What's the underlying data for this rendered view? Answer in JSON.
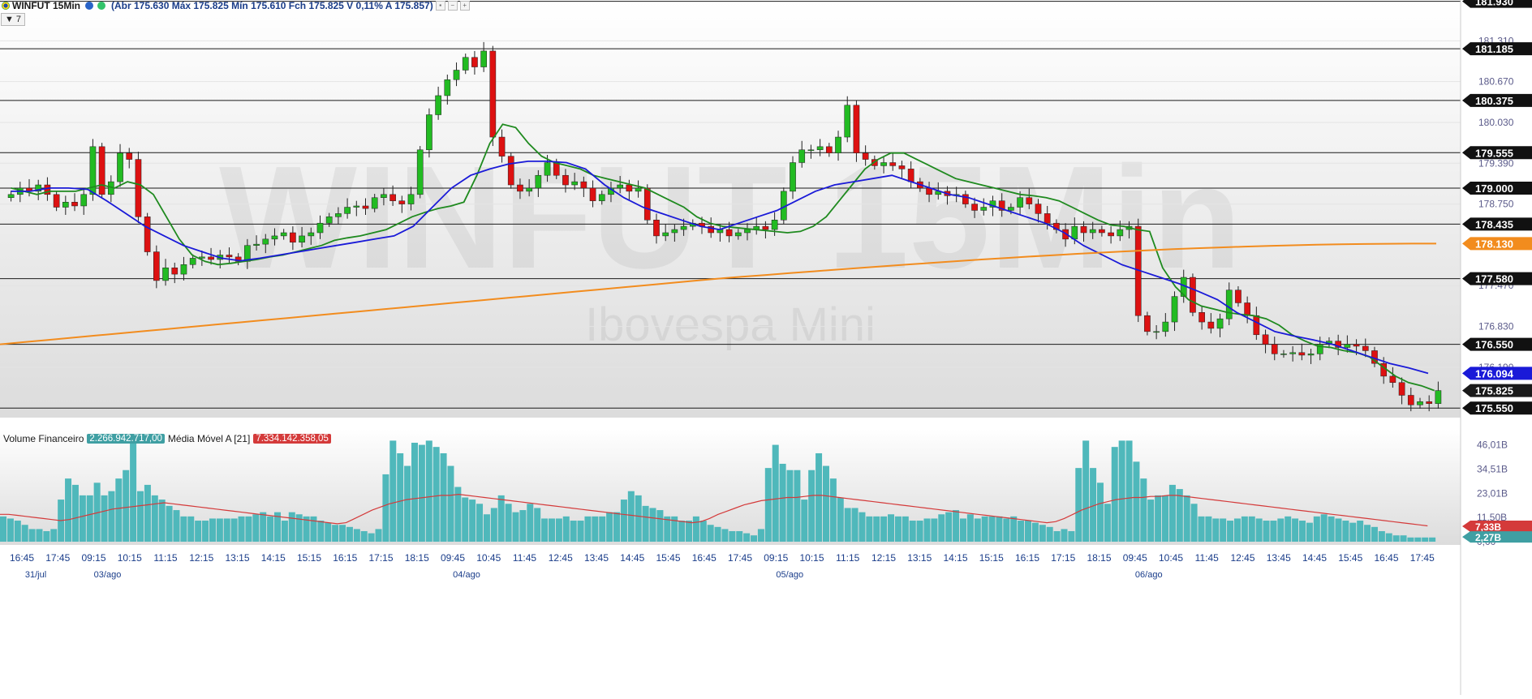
{
  "header": {
    "symbol": "WINFUT 15Min",
    "ohlc_text": "(Abr 175.630 Máx 175.825 Mín 175.610 Fch 175.825 V 0,11% A 175.857)",
    "collapse_label": "7"
  },
  "watermark": {
    "main": "WINFUT 15Min",
    "sub": "Ibovespa Mini"
  },
  "colors": {
    "up": "#22bb22",
    "down": "#dd1111",
    "ma_fast": "#1f8a1f",
    "ma_mid": "#1a1ad8",
    "ma_slow": "#f28c1e",
    "volume": "#4fb8bb",
    "volume_ma": "#d43a3a"
  },
  "chart_data": [
    {
      "type": "candlestick",
      "title": "WINFUT 15Min",
      "ylim": [
        175.4,
        181.95
      ],
      "price_ticks": [
        "181.310",
        "180.670",
        "180.030",
        "179.390",
        "178.750",
        "177.470",
        "176.830",
        "176.190"
      ],
      "horizontal_levels": [
        181.93,
        181.185,
        180.375,
        179.555,
        179.0,
        178.435,
        177.58,
        176.55,
        175.55
      ],
      "level_labels": [
        "181.930",
        "181.185",
        "180.375",
        "179.555",
        "179.000",
        "178.435",
        "177.580",
        "176.550",
        "175.550"
      ],
      "badges": [
        {
          "label": "178.130",
          "value": 178.13,
          "color": "#f28c1e"
        },
        {
          "label": "176.094",
          "value": 176.094,
          "color": "#1a1ad8"
        },
        {
          "label": "175.825",
          "value": 175.825,
          "color": "#1a1a1a"
        }
      ],
      "candles_close": [
        178.9,
        179.0,
        178.95,
        179.05,
        178.9,
        178.7,
        178.78,
        178.72,
        178.9,
        179.65,
        178.9,
        179.1,
        179.55,
        179.45,
        178.55,
        178.0,
        177.55,
        177.75,
        177.65,
        177.8,
        177.9,
        177.92,
        177.88,
        177.95,
        177.92,
        177.85,
        178.1,
        178.12,
        178.2,
        178.25,
        178.3,
        178.15,
        178.25,
        178.3,
        178.45,
        178.55,
        178.6,
        178.7,
        178.72,
        178.68,
        178.85,
        178.9,
        178.8,
        178.75,
        178.9,
        179.6,
        180.15,
        180.45,
        180.7,
        180.85,
        181.05,
        180.9,
        181.15,
        179.8,
        179.5,
        179.05,
        178.95,
        179.0,
        179.2,
        179.4,
        179.2,
        179.05,
        179.1,
        179.0,
        178.8,
        178.9,
        179.0,
        179.05,
        178.95,
        179.0,
        178.5,
        178.25,
        178.3,
        178.35,
        178.4,
        178.45,
        178.4,
        178.3,
        178.35,
        178.25,
        178.3,
        178.35,
        178.4,
        178.35,
        178.5,
        178.95,
        179.4,
        179.6,
        179.6,
        179.65,
        179.55,
        179.8,
        180.3,
        179.55,
        179.45,
        179.35,
        179.4,
        179.35,
        179.3,
        179.1,
        179.0,
        178.9,
        178.95,
        178.88,
        178.9,
        178.75,
        178.65,
        178.7,
        178.8,
        178.65,
        178.7,
        178.85,
        178.75,
        178.6,
        178.45,
        178.35,
        178.2,
        178.4,
        178.3,
        178.35,
        178.3,
        178.25,
        178.35,
        178.4,
        177.0,
        176.75,
        176.75,
        176.9,
        177.3,
        177.6,
        177.05,
        176.9,
        176.8,
        176.95,
        177.4,
        177.2,
        177.0,
        176.7,
        176.55,
        176.4,
        176.4,
        176.42,
        176.38,
        176.4,
        176.55,
        176.6,
        176.5,
        176.55,
        176.52,
        176.45,
        176.25,
        176.05,
        175.95,
        175.75,
        175.6,
        175.65,
        175.62,
        175.825
      ],
      "sma_fast": [
        179.0,
        178.95,
        178.9,
        178.95,
        178.95,
        178.95,
        179.0,
        179.05,
        179.0,
        179.1,
        179.05,
        178.9,
        178.55,
        178.2,
        177.95,
        177.85,
        177.8,
        177.82,
        177.85,
        177.88,
        177.92,
        177.95,
        178.0,
        178.05,
        178.1,
        178.18,
        178.22,
        178.25,
        178.3,
        178.35,
        178.45,
        178.55,
        178.62,
        178.68,
        178.72,
        178.78,
        179.2,
        179.7,
        180.0,
        179.95,
        179.7,
        179.5,
        179.4,
        179.35,
        179.3,
        179.2,
        179.15,
        179.1,
        179.05,
        179.0,
        178.9,
        178.8,
        178.7,
        178.55,
        178.45,
        178.4,
        178.38,
        178.36,
        178.34,
        178.32,
        178.3,
        178.32,
        178.4,
        178.55,
        178.8,
        179.05,
        179.3,
        179.45,
        179.55,
        179.55,
        179.45,
        179.35,
        179.25,
        179.15,
        179.1,
        179.05,
        179.0,
        178.95,
        178.9,
        178.88,
        178.85,
        178.8,
        178.7,
        178.6,
        178.5,
        178.42,
        178.4,
        178.35,
        178.32,
        177.75,
        177.45,
        177.25,
        177.15,
        177.1,
        177.05,
        177.02,
        177.0,
        176.95,
        176.85,
        176.7,
        176.6,
        176.52,
        176.5,
        176.45,
        176.42,
        176.35,
        176.2,
        176.05,
        175.95,
        175.9,
        175.825
      ],
      "sma_mid": [
        178.95,
        178.95,
        179.0,
        179.0,
        178.98,
        178.8,
        178.6,
        178.4,
        178.25,
        178.1,
        178.0,
        177.9,
        177.86,
        177.9,
        177.95,
        178.0,
        178.05,
        178.1,
        178.15,
        178.2,
        178.25,
        178.4,
        178.7,
        179.0,
        179.2,
        179.3,
        179.38,
        179.42,
        179.42,
        179.4,
        179.3,
        179.05,
        178.85,
        178.7,
        178.6,
        178.5,
        178.4,
        178.35,
        178.45,
        178.55,
        178.65,
        178.8,
        178.95,
        179.05,
        179.1,
        179.15,
        179.2,
        179.1,
        179.0,
        178.9,
        178.85,
        178.75,
        178.65,
        178.55,
        178.45,
        178.3,
        178.1,
        177.95,
        177.8,
        177.7,
        177.6,
        177.5,
        177.38,
        177.25,
        177.05,
        176.9,
        176.75,
        176.68,
        176.62,
        176.55,
        176.45,
        176.35,
        176.25,
        176.18,
        176.094
      ],
      "sma_slow_start": 176.55,
      "sma_slow_mid": 177.58,
      "sma_slow_end": 178.13,
      "sessions": [
        {
          "date": "31/jul",
          "times": [
            "16:45",
            "17:45"
          ]
        },
        {
          "date": "03/ago",
          "times": [
            "09:15",
            "10:15",
            "11:15",
            "12:15",
            "13:15",
            "14:15",
            "15:15",
            "16:15",
            "17:15",
            "18:15"
          ]
        },
        {
          "date": "04/ago",
          "times": [
            "09:45",
            "10:45",
            "11:45",
            "12:45",
            "13:45",
            "14:45",
            "15:45",
            "16:45",
            "17:45"
          ]
        },
        {
          "date": "05/ago",
          "times": [
            "09:15",
            "10:15",
            "11:15",
            "12:15",
            "13:15",
            "14:15",
            "15:15",
            "16:15",
            "17:15",
            "18:15"
          ]
        },
        {
          "date": "06/ago",
          "times": [
            "09:45",
            "10:45",
            "11:45",
            "12:45",
            "13:45",
            "14:45",
            "15:45",
            "16:45",
            "17:45"
          ]
        }
      ]
    },
    {
      "type": "bar",
      "title": "Volume Financeiro",
      "last_value_label": "2.266.942.717,00",
      "ma_label": "Média Móvel A [21]",
      "ma_value_label": "7.334.142.358,05",
      "ylim": [
        0,
        52
      ],
      "unit": "B",
      "y_ticks": [
        "46,01B",
        "34,51B",
        "23,01B",
        "11,50B",
        "0,00"
      ],
      "badges": [
        {
          "label": "7,33B",
          "value": 7.33,
          "color": "#d43a3a"
        },
        {
          "label": "2,27B",
          "value": 2.27,
          "color": "#3f9fa3"
        }
      ],
      "volumes": [
        12,
        11,
        10,
        8,
        6,
        6,
        5,
        6,
        20,
        30,
        27,
        22,
        22,
        28,
        22,
        24,
        30,
        34,
        48,
        24,
        27,
        22,
        20,
        17,
        15,
        12,
        12,
        10,
        10,
        11,
        11,
        11,
        11,
        12,
        12,
        13,
        14,
        12,
        14,
        10,
        14,
        13,
        12,
        12,
        10,
        9,
        8,
        8,
        7,
        6,
        5,
        4,
        6,
        32,
        48,
        42,
        36,
        47,
        46,
        48,
        45,
        42,
        36,
        26,
        21,
        20,
        18,
        13,
        16,
        22,
        18,
        14,
        15,
        18,
        16,
        11,
        11,
        11,
        12,
        10,
        10,
        12,
        12,
        12,
        14,
        14,
        20,
        24,
        22,
        17,
        16,
        15,
        12,
        12,
        10,
        10,
        12,
        10,
        8,
        7,
        6,
        5,
        5,
        4,
        3,
        6,
        35,
        46,
        37,
        34,
        34,
        20,
        34,
        42,
        36,
        30,
        21,
        16,
        16,
        14,
        12,
        12,
        12,
        13,
        12,
        12,
        10,
        10,
        11,
        11,
        13,
        14,
        15,
        11,
        13,
        11,
        12,
        12,
        12,
        11,
        12,
        10,
        10,
        9,
        8,
        7,
        5,
        6,
        5,
        35,
        48,
        35,
        28,
        18,
        45,
        48,
        48,
        38,
        30,
        20,
        22,
        22,
        27,
        25,
        22,
        18,
        12,
        12,
        11,
        11,
        10,
        11,
        12,
        12,
        11,
        10,
        10,
        11,
        12,
        11,
        10,
        9,
        12,
        13,
        12,
        11,
        10,
        9,
        10,
        8,
        7,
        5,
        4,
        3,
        3,
        2,
        2,
        2,
        2
      ],
      "volume_ma": [
        13,
        13,
        12.5,
        12,
        11.5,
        11,
        10.5,
        10,
        10.5,
        11.5,
        12.5,
        13.5,
        14.5,
        15.5,
        16,
        16.5,
        17,
        17.5,
        18,
        18.5,
        18,
        17.5,
        17,
        16.5,
        16,
        15.5,
        15,
        14.5,
        14,
        13.5,
        13,
        12.5,
        12,
        11.5,
        11,
        10.5,
        10,
        9.5,
        9,
        8.5,
        9,
        11,
        13,
        15,
        16.5,
        18,
        19,
        20,
        20.5,
        21,
        21.5,
        22,
        22,
        22.5,
        22,
        21.5,
        21,
        20.5,
        20,
        19.5,
        19,
        18.5,
        18,
        17.5,
        17,
        16.5,
        16,
        15.5,
        15,
        14.5,
        14,
        13.5,
        13,
        12.5,
        12,
        11.5,
        11,
        10.5,
        10,
        9.5,
        9,
        9.5,
        11,
        13,
        14.5,
        16,
        17.5,
        18.5,
        19.5,
        20,
        20.5,
        21,
        21,
        21.5,
        22,
        22,
        21.5,
        21,
        20.5,
        20,
        19.5,
        19,
        18.5,
        18,
        17.5,
        17,
        16.5,
        16,
        15.5,
        15,
        14.5,
        14,
        13.5,
        13,
        12.5,
        12,
        11.5,
        11,
        10.5,
        10,
        9.5,
        9,
        9.5,
        11,
        13,
        15,
        16.5,
        18,
        19,
        20,
        20.5,
        21,
        21,
        21.5,
        21.5,
        22,
        22,
        21.5,
        21,
        20.5,
        20,
        19.5,
        19,
        18.5,
        18,
        17.5,
        17,
        16.5,
        16,
        15.5,
        15,
        14.5,
        14,
        13.5,
        13,
        12.5,
        12,
        11.5,
        11,
        10.5,
        10,
        9.5,
        9,
        8.5,
        8,
        7.5
      ]
    }
  ]
}
